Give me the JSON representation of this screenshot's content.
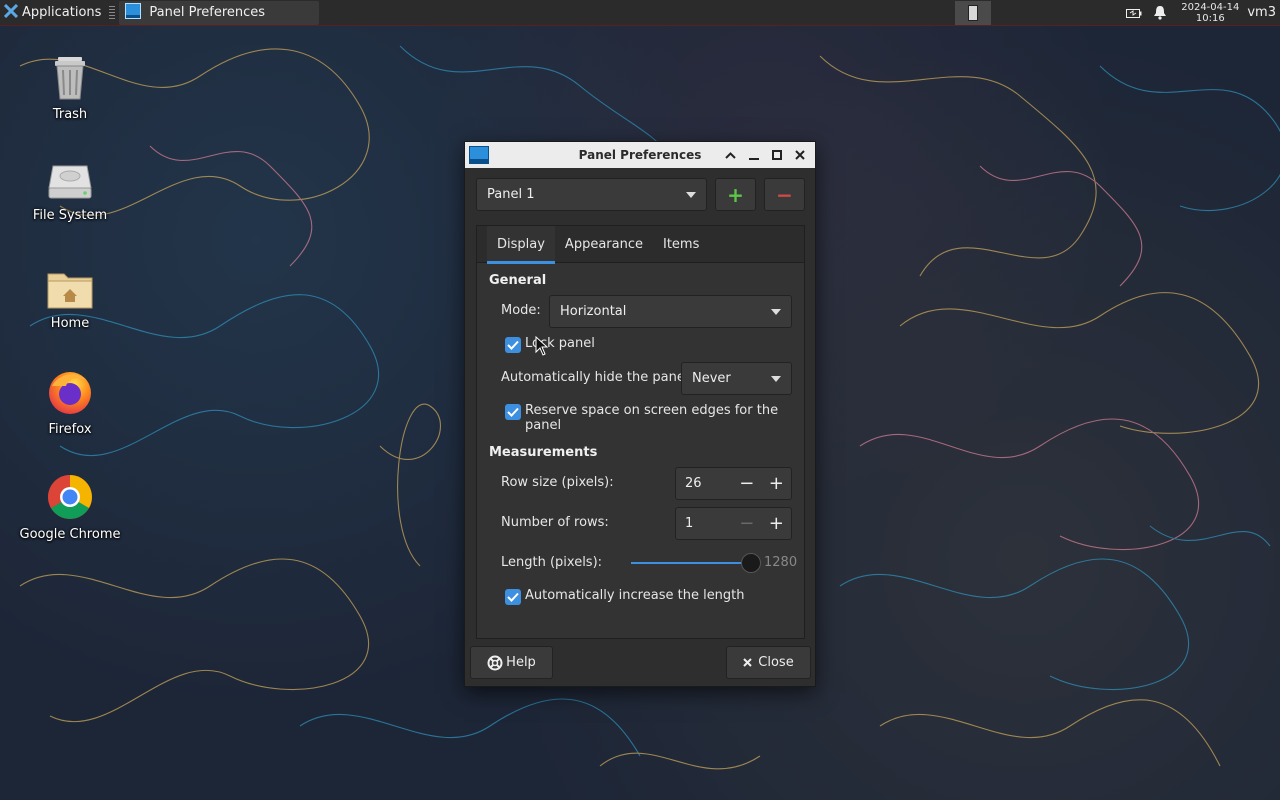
{
  "top_panel": {
    "applications_label": "Applications",
    "task_label": "Panel Preferences",
    "clock_date": "2024-04-14",
    "clock_time": "10:16",
    "user_label": "vm3"
  },
  "desktop_icons": [
    {
      "label": "Trash",
      "icon": "trash-icon"
    },
    {
      "label": "File System",
      "icon": "drive-icon"
    },
    {
      "label": "Home",
      "icon": "home-folder-icon"
    },
    {
      "label": "Firefox",
      "icon": "firefox-icon"
    },
    {
      "label": "Google Chrome",
      "icon": "chrome-icon"
    }
  ],
  "dialog": {
    "title": "Panel Preferences",
    "panel_select": "Panel 1",
    "add_label": "+",
    "remove_label": "−",
    "tabs": [
      "Display",
      "Appearance",
      "Items"
    ],
    "active_tab": "Display",
    "general": {
      "heading": "General",
      "mode_label": "Mode:",
      "mode_value": "Horizontal",
      "lock_label": "Lock panel",
      "lock_checked": true,
      "autohide_label": "Automatically hide the panel:",
      "autohide_value": "Never",
      "reserve_label": "Reserve space on screen edges for the panel",
      "reserve_checked": true
    },
    "measurements": {
      "heading": "Measurements",
      "row_size_label": "Row size (pixels):",
      "row_size_value": "26",
      "rows_label": "Number of rows:",
      "rows_value": "1",
      "length_label": "Length (pixels):",
      "length_value": "1280",
      "length_fraction": 1.0,
      "auto_length_label": "Automatically increase the length",
      "auto_length_checked": true
    },
    "help_label": "Help",
    "close_label": "Close"
  },
  "colors": {
    "accent": "#3d8fe0",
    "add_green": "#5fc44a",
    "remove_red": "#d04a4a"
  }
}
